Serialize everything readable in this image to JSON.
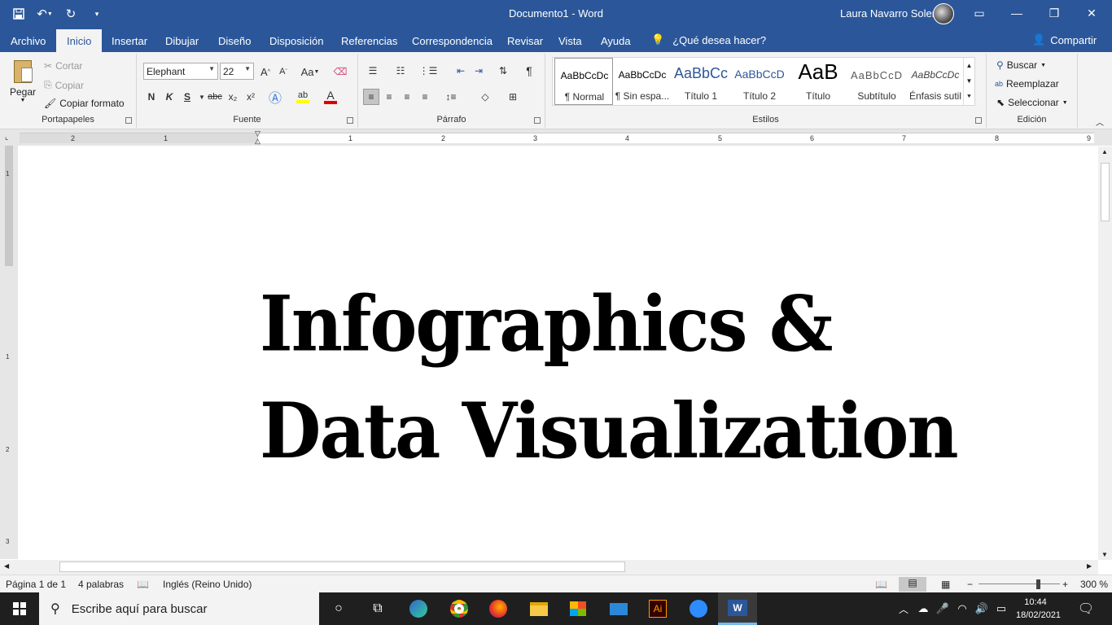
{
  "window": {
    "title": "Documento1  -  Word",
    "user": "Laura Navarro Soler"
  },
  "qat": {
    "save_icon": "save-icon",
    "undo_icon": "undo-icon",
    "redo_icon": "redo-icon"
  },
  "tabs": [
    "Archivo",
    "Inicio",
    "Insertar",
    "Dibujar",
    "Diseño",
    "Disposición",
    "Referencias",
    "Correspondencia",
    "Revisar",
    "Vista",
    "Ayuda"
  ],
  "tellme": "¿Qué desea hacer?",
  "share": "Compartir",
  "clipboard": {
    "paste": "Pegar",
    "cut": "Cortar",
    "copy": "Copiar",
    "format_painter": "Copiar formato",
    "label": "Portapapeles"
  },
  "font": {
    "name": "Elephant",
    "size": "22",
    "label": "Fuente",
    "grow": "A",
    "shrink": "A",
    "case": "Aa",
    "bold": "N",
    "italic": "K",
    "underline": "S",
    "strike": "abc",
    "sub": "x₂",
    "sup": "x²",
    "color_letter": "A",
    "text_color": "#e00000",
    "highlight_color": "#ffff00"
  },
  "paragraph": {
    "label": "Párrafo",
    "pilcrow": "¶"
  },
  "styles": {
    "label": "Estilos",
    "items": [
      {
        "preview": "AaBbCcDc",
        "name": "¶ Normal"
      },
      {
        "preview": "AaBbCcDc",
        "name": "¶ Sin espa..."
      },
      {
        "preview": "AaBbCc",
        "name": "Título 1"
      },
      {
        "preview": "AaBbCcD",
        "name": "Título 2"
      },
      {
        "preview": "AaB",
        "name": "Título"
      },
      {
        "preview": "AaBbCcD",
        "name": "Subtítulo"
      },
      {
        "preview": "AaBbCcDc",
        "name": "Énfasis sutil"
      }
    ]
  },
  "editing": {
    "find": "Buscar",
    "replace": "Reemplazar",
    "select": "Seleccionar",
    "label": "Edición"
  },
  "ruler": {
    "numbers": [
      "2",
      "1",
      "1",
      "2",
      "3",
      "4",
      "5",
      "6",
      "7",
      "8",
      "9"
    ]
  },
  "vruler": {
    "numbers": [
      "1",
      "1",
      "2",
      "3"
    ]
  },
  "document": {
    "line1": "Infographics &",
    "line2": "Data Visualization"
  },
  "status": {
    "page": "Página 1 de 1",
    "words": "4 palabras",
    "language": "Inglés (Reino Unido)",
    "zoom": "300 %",
    "zoom_minus": "−",
    "zoom_plus": "+"
  },
  "taskbar": {
    "search_placeholder": "Escribe aquí para buscar",
    "time": "10:44",
    "date": "18/02/2021",
    "ai_label": "Ai"
  }
}
